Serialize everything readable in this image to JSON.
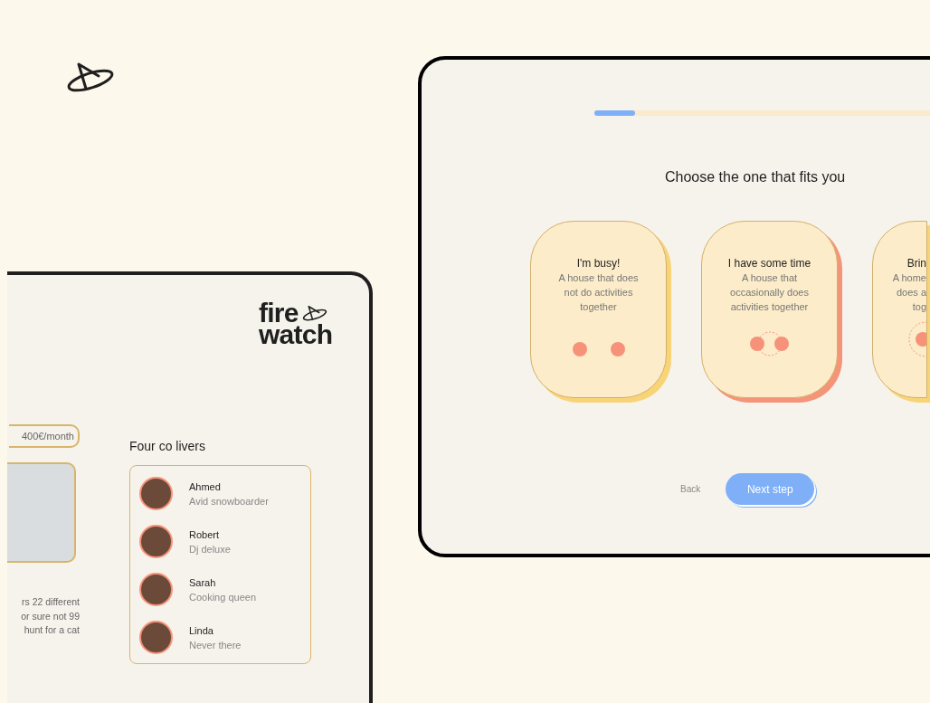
{
  "profile_screen": {
    "logo": {
      "line_1": "fire",
      "line_2": "watch"
    },
    "price": "400€/month",
    "description_lines": [
      "rs 22 different",
      "or sure not 99",
      "hunt for a cat"
    ],
    "colivers": {
      "title": "Four co livers",
      "people": [
        {
          "name": "Ahmed",
          "tagline": "Avid snowboarder"
        },
        {
          "name": "Robert",
          "tagline": "Dj deluxe"
        },
        {
          "name": "Sarah",
          "tagline": "Cooking queen"
        },
        {
          "name": "Linda",
          "tagline": "Never there"
        }
      ]
    }
  },
  "quiz_screen": {
    "progress": {
      "level": 0.12
    },
    "heading": "Choose the one that fits you",
    "options": [
      {
        "title": "I'm busy!",
        "description_lines": [
          "A house that does",
          "not do activities",
          "together"
        ],
        "kind": "apart",
        "selected": false
      },
      {
        "title": "I have some time",
        "description_lines": [
          "A house that",
          "occasionally does",
          "activities together"
        ],
        "kind": "near",
        "selected": true
      },
      {
        "title": "Brin",
        "description_lines": [
          "A home",
          "does a",
          "tog"
        ],
        "kind": "together",
        "selected": false
      }
    ],
    "back": "Back",
    "next": "Next step"
  }
}
